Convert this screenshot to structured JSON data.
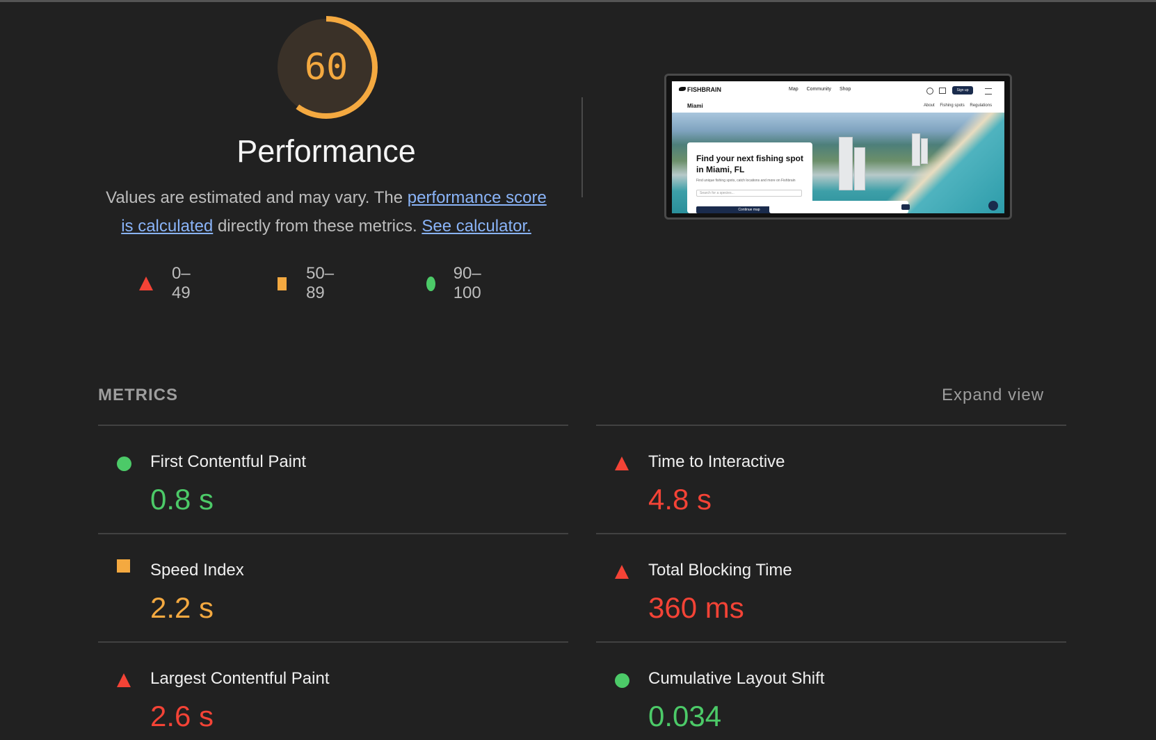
{
  "score": {
    "value": "60",
    "fraction": 0.6,
    "title": "Performance",
    "color": "#f4a940"
  },
  "description": {
    "text_before": "Values are estimated and may vary. The ",
    "link_score": "performance score is calculated",
    "text_middle": " directly from these metrics. ",
    "link_calc": "See calculator."
  },
  "legend": [
    {
      "icon": "triangle-red",
      "label": "0–49"
    },
    {
      "icon": "square-orange",
      "label": "50–89"
    },
    {
      "icon": "circle-green",
      "label": "90–100"
    }
  ],
  "screenshot": {
    "logo": "FISHBRAIN",
    "nav_links": [
      "Map",
      "Community",
      "Shop"
    ],
    "signup": "Sign up",
    "location": "Miami",
    "tabs": [
      "About",
      "Fishing spots",
      "Regulations"
    ],
    "card_title": "Find your next fishing spot in Miami, FL",
    "card_subtitle": "Find unique fishing spots, catch locations and more on Fishbrain",
    "search_placeholder": "Search for a species...",
    "card_button": "Continue map"
  },
  "metrics": {
    "heading": "METRICS",
    "expand": "Expand view",
    "items": [
      {
        "label": "First Contentful Paint",
        "value": "0.8 s",
        "status": "green"
      },
      {
        "label": "Time to Interactive",
        "value": "4.8 s",
        "status": "red"
      },
      {
        "label": "Speed Index",
        "value": "2.2 s",
        "status": "orange"
      },
      {
        "label": "Total Blocking Time",
        "value": "360 ms",
        "status": "red"
      },
      {
        "label": "Largest Contentful Paint",
        "value": "2.6 s",
        "status": "red"
      },
      {
        "label": "Cumulative Layout Shift",
        "value": "0.034",
        "status": "green"
      }
    ]
  },
  "colors": {
    "background": "#212121",
    "green": "#4cca68",
    "orange": "#f4a940",
    "red": "#f44336",
    "link": "#8ab4f8"
  }
}
